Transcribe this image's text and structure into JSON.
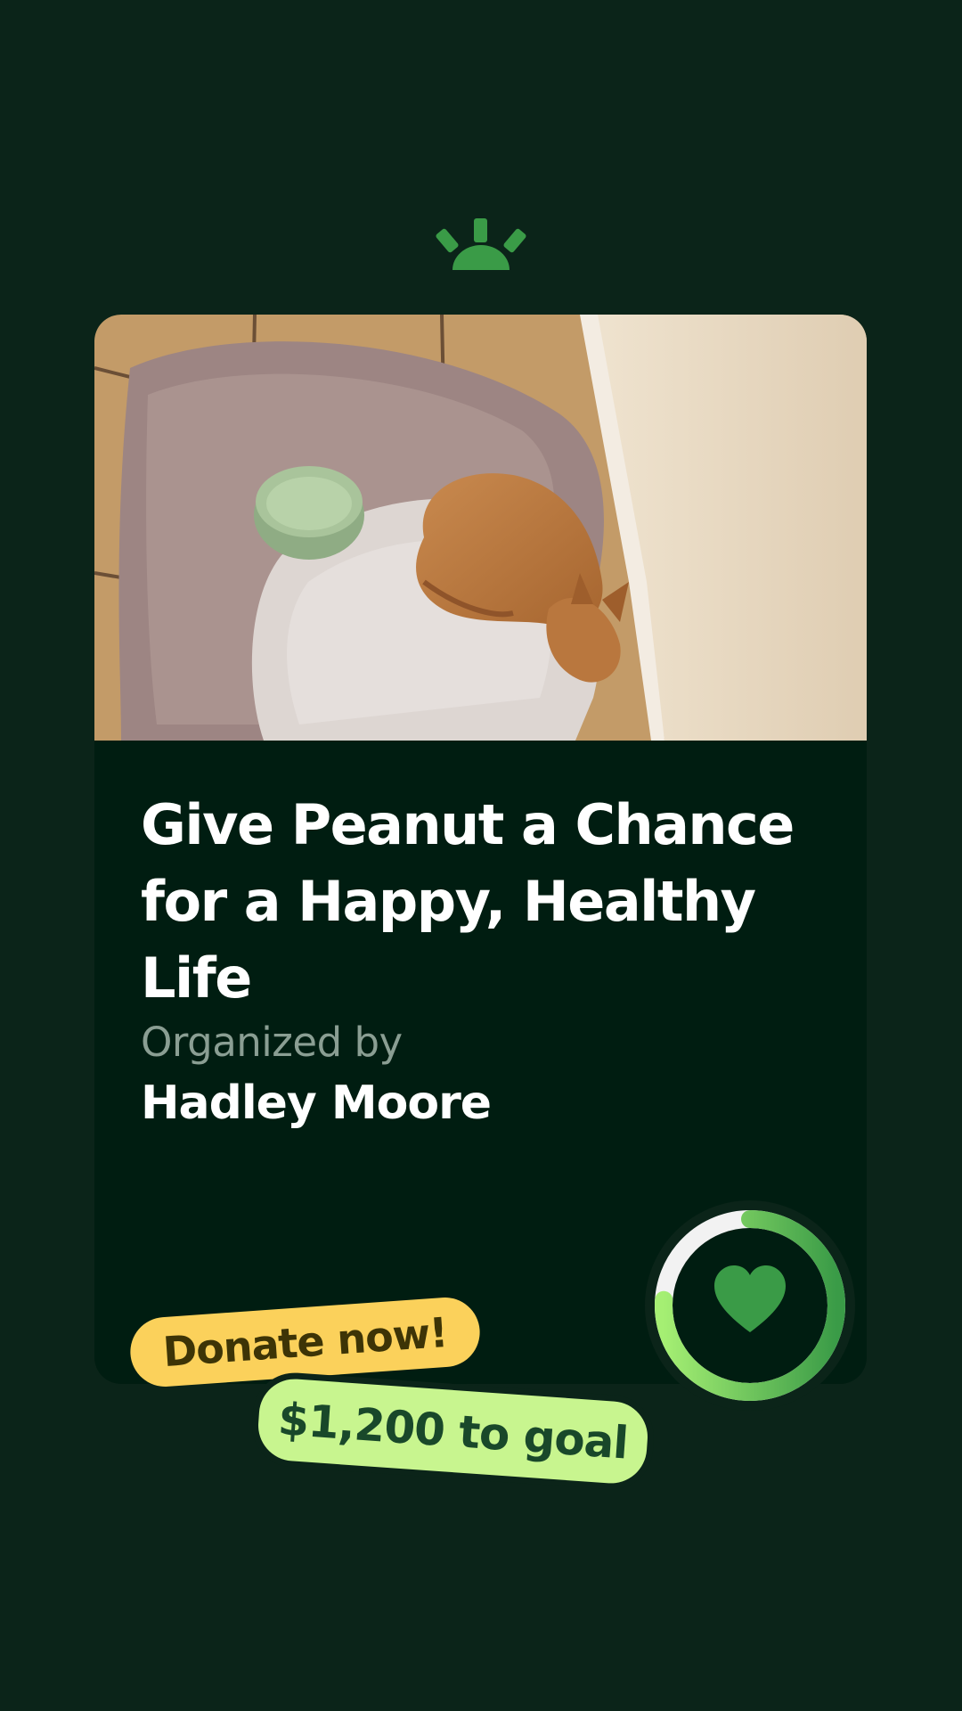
{
  "campaign": {
    "title": "Give Peanut a Chance for a Happy, Healthy Life",
    "organizer_label": "Organized by",
    "organizer_name": "Hadley Moore"
  },
  "cta": {
    "donate_label": "Donate now!",
    "goal_label": "$1,200 to goal"
  },
  "icons": {
    "brand": "sunrise-logo-icon",
    "progress": "heart-icon"
  },
  "colors": {
    "background": "#0b2419",
    "card": "#001d11",
    "brand_green": "#3a9b47",
    "progress_light": "#a5ef73",
    "progress_dark": "#3a9b47",
    "donate_pill": "#fbd15b",
    "goal_pill": "#c8f58f"
  },
  "progress": {
    "fraction_complete": 0.76
  }
}
